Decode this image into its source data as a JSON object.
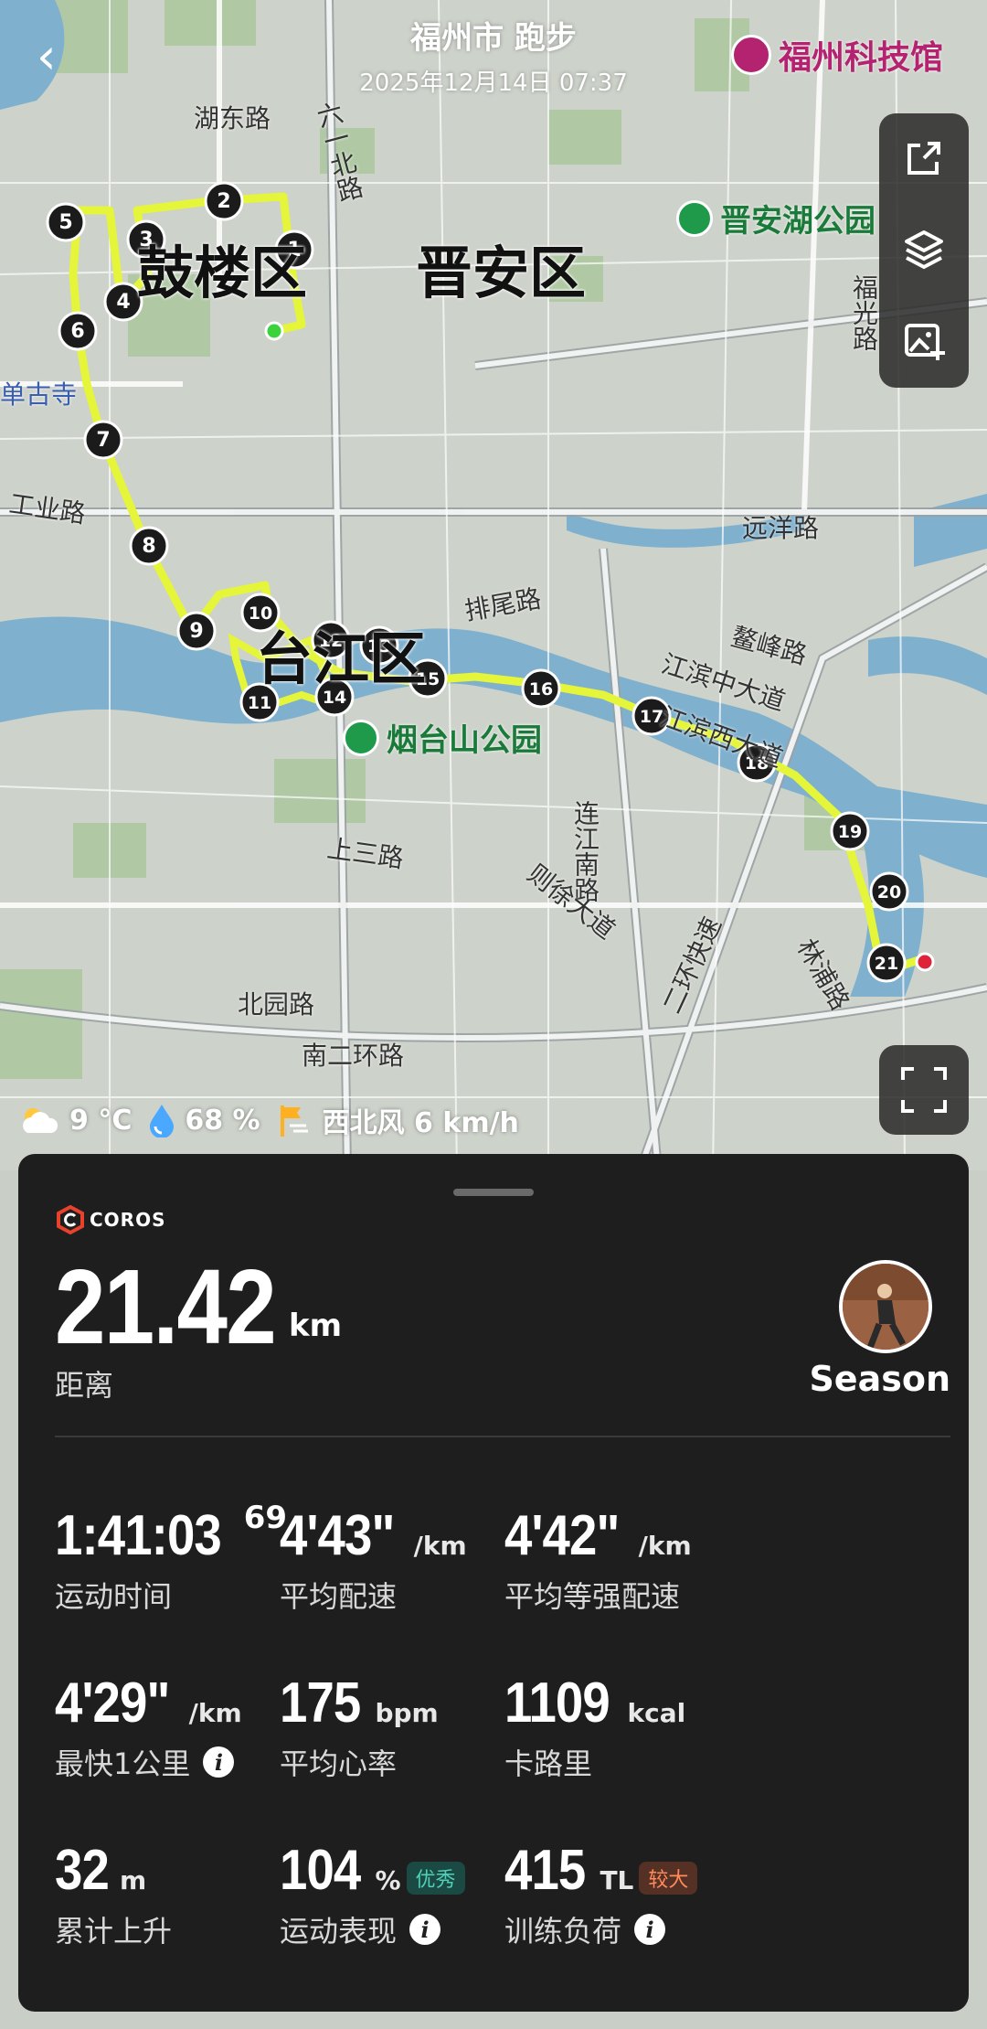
{
  "header": {
    "title": "福州市 跑步",
    "datetime": "2025年12月14日 07:37"
  },
  "map": {
    "districts": [
      "鼓楼区",
      "晋安区",
      "台江区"
    ],
    "roads": [
      "湖东路",
      "六一北路",
      "福光路",
      "工业路",
      "远洋路",
      "排尾路",
      "鳌峰路",
      "江滨中大道",
      "上三路",
      "连江南路",
      "则徐大道",
      "北园路",
      "南二环路",
      "二环快速",
      "林浦路",
      "江滨西大道"
    ],
    "parks": [
      "晋安湖公园",
      "烟台山公园"
    ],
    "poi": "福州科技馆",
    "poi_partial": "单古寺",
    "route_color": "#e4f53a",
    "markers": [
      "1",
      "2",
      "3",
      "4",
      "5",
      "6",
      "7",
      "8",
      "9",
      "10",
      "11",
      "12",
      "13",
      "14",
      "15",
      "16",
      "17",
      "18",
      "19",
      "20",
      "21"
    ]
  },
  "weather": {
    "temp": "9 °C",
    "humidity": "68 %",
    "wind": "西北风 6 km/h"
  },
  "card": {
    "brand": "COROS",
    "distance": "21.42",
    "distance_unit": "km",
    "distance_label": "距离",
    "user_name": "Season",
    "stats": [
      {
        "value": "1:41:03",
        "sup": "69",
        "unit": "",
        "label": "运动时间"
      },
      {
        "value": "4'43\"",
        "unit": "/km",
        "label": "平均配速"
      },
      {
        "value": "4'42\"",
        "unit": "/km",
        "label": "平均等强配速"
      },
      {
        "value": "4'29\"",
        "unit": "/km",
        "label": "最快1公里"
      },
      {
        "value": "175",
        "unit": "bpm",
        "label": "平均心率"
      },
      {
        "value": "1109",
        "unit": "kcal",
        "label": "卡路里"
      },
      {
        "value": "32",
        "unit": "m",
        "label": "累计上升"
      },
      {
        "value": "104",
        "unit": "%",
        "badge": "优秀",
        "label": "运动表现"
      },
      {
        "value": "415",
        "unit": "TL",
        "badge": "较大",
        "label": "训练负荷"
      }
    ]
  }
}
